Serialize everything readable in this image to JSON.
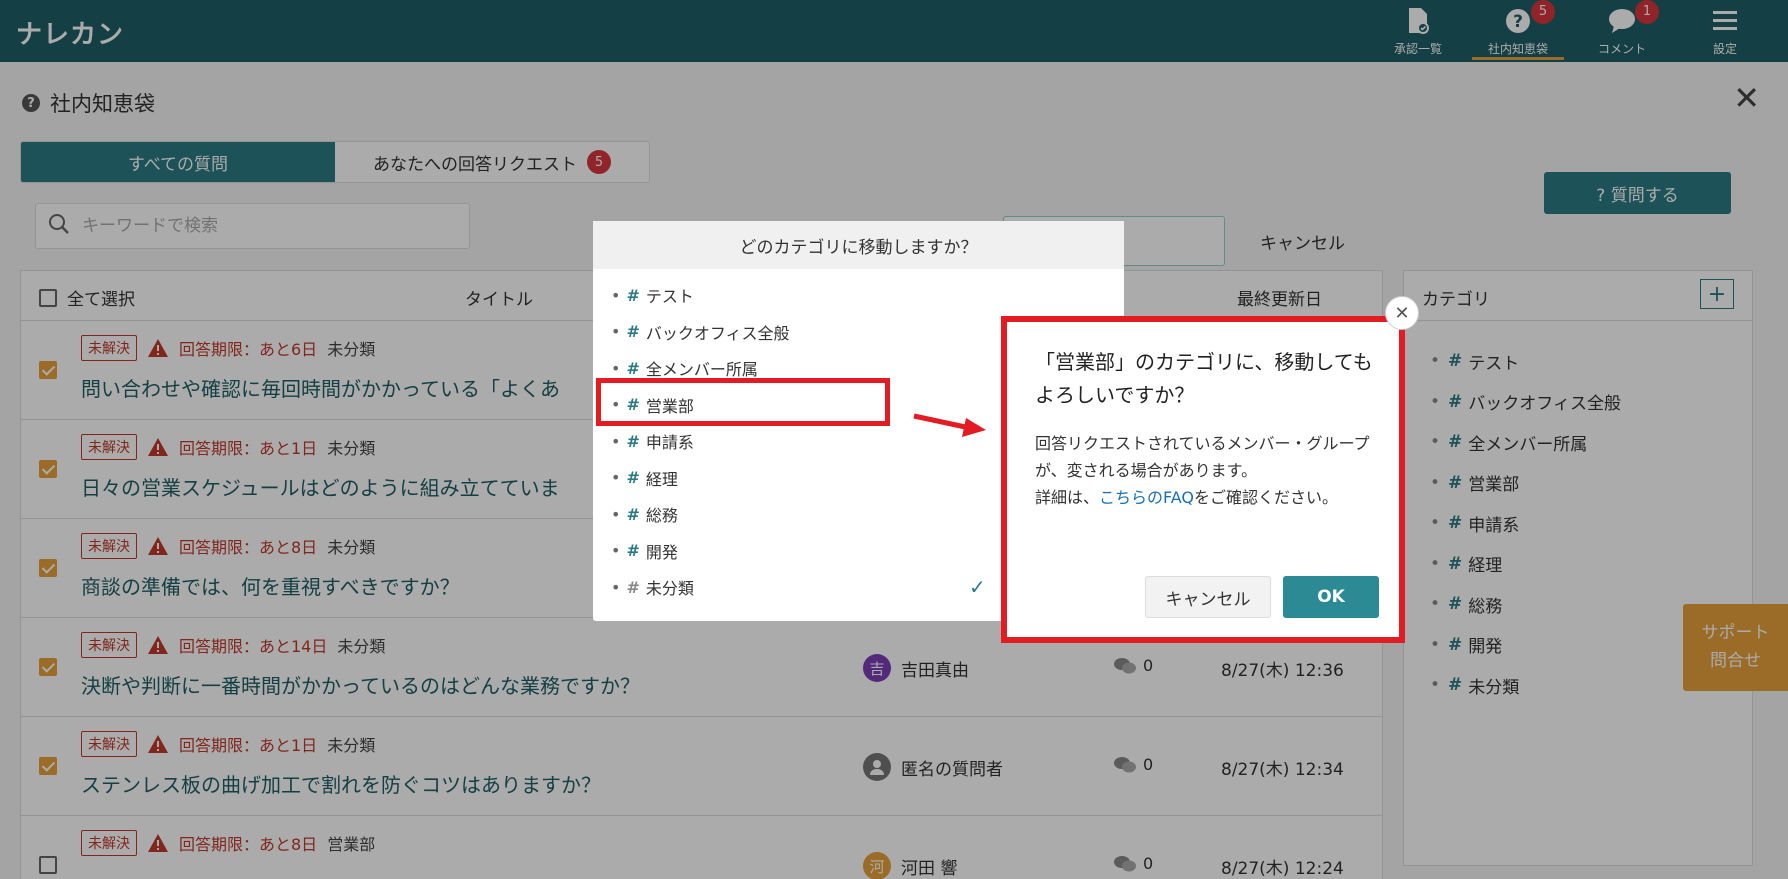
{
  "app": {
    "logo": "ナレカン"
  },
  "header_nav": [
    {
      "label": "承認一覧",
      "icon": "approval-doc-icon",
      "badge": null
    },
    {
      "label": "社内知恵袋",
      "icon": "question-circle-icon",
      "badge": "5"
    },
    {
      "label": "コメント",
      "icon": "comment-bubble-icon",
      "badge": "1"
    },
    {
      "label": "設定",
      "icon": "menu-hamburger-icon",
      "badge": null
    }
  ],
  "page": {
    "title": "社内知恵袋",
    "close_glyph": "✕"
  },
  "tabs": [
    {
      "label": "すべての質問"
    },
    {
      "label": "あなたへの回答リクエスト",
      "badge": "5"
    }
  ],
  "search": {
    "placeholder": "キーワードで検索"
  },
  "ask_button": "? 質問する",
  "bg_cancel": "キャンセル",
  "list": {
    "select_all": "全て選択",
    "col_title": "タイトル",
    "col_date": "最終更新日",
    "rows": [
      {
        "checked": true,
        "status": "未解決",
        "deadline": "回答期限：あと6日",
        "category": "未分類",
        "title": "問い合わせや確認に毎回時間がかかっている「よくあ",
        "user": "",
        "user_initial": "",
        "comments": "",
        "date": ""
      },
      {
        "checked": true,
        "status": "未解決",
        "deadline": "回答期限：あと1日",
        "category": "未分類",
        "title": "日々の営業スケジュールはどのように組み立てていま",
        "user": "",
        "user_initial": "",
        "comments": "",
        "date": ""
      },
      {
        "checked": true,
        "status": "未解決",
        "deadline": "回答期限：あと8日",
        "category": "未分類",
        "title": "商談の準備では、何を重視すべきですか？",
        "user": "",
        "user_initial": "",
        "comments": "",
        "date": ""
      },
      {
        "checked": true,
        "status": "未解決",
        "deadline": "回答期限：あと14日",
        "category": "未分類",
        "title": "決断や判断に一番時間がかかっているのはどんな業務ですか？",
        "user": "吉田真由",
        "user_initial": "吉",
        "avatar_color": "#7b3fb5",
        "comments": "0",
        "date": "8/27(木) 12:36"
      },
      {
        "checked": true,
        "status": "未解決",
        "deadline": "回答期限：あと1日",
        "category": "未分類",
        "title": "ステンレス板の曲げ加工で割れを防ぐコツはありますか？",
        "user": "匿名の質問者",
        "user_initial": "",
        "avatar_color": "#777777",
        "comments": "0",
        "date": "8/27(木) 12:34"
      },
      {
        "checked": false,
        "status": "未解決",
        "deadline": "回答期限：あと8日",
        "category": "営業部",
        "title": "",
        "user": "河田 響",
        "user_initial": "河",
        "avatar_color": "#e6a23c",
        "comments": "0",
        "date": "8/27(木) 12:24"
      }
    ]
  },
  "category_panel": {
    "title": "カテゴリ",
    "add": "+",
    "items": [
      "テスト",
      "バックオフィス全般",
      "全メンバー所属",
      "営業部",
      "申請系",
      "経理",
      "総務",
      "開発",
      "未分類"
    ]
  },
  "support": {
    "line1": "サポート",
    "line2": "問合せ"
  },
  "move_dialog": {
    "title": "どのカテゴリに移動しますか？",
    "hash": "#",
    "items": [
      "テスト",
      "バックオフィス全般",
      "全メンバー所属",
      "営業部",
      "申請系",
      "経理",
      "総務",
      "開発",
      "未分類"
    ],
    "checkmark": "✓"
  },
  "confirm_dialog": {
    "title": "「営業部」のカテゴリに、移動してもよろしいですか？",
    "body_line1": "回答リクエストされているメンバー・グループが、変される場合があります。",
    "body_line2_prefix": "詳細は、",
    "body_link": "こちらのFAQ",
    "body_line2_suffix": "をご確認ください。",
    "cancel": "キャンセル",
    "ok": "OK",
    "close": "✕"
  },
  "colors": {
    "header": "#1f5f66",
    "accent": "#2c7b84",
    "highlight": "#e31b23",
    "badge": "#d9363e",
    "check": "#e6a23c"
  }
}
